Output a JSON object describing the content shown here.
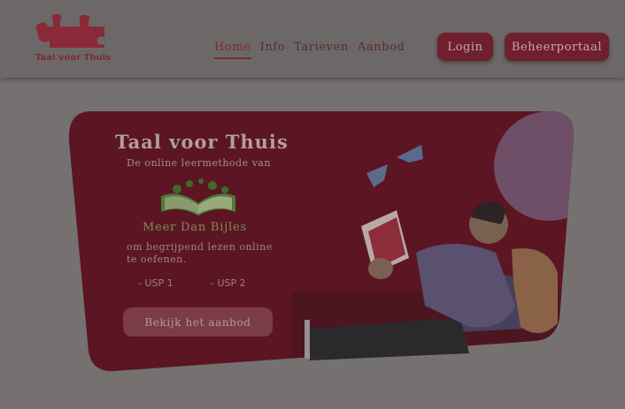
{
  "header": {
    "logo_text": "Taal voor Thuis",
    "nav": [
      {
        "label": "Home",
        "active": true
      },
      {
        "label": "Info",
        "active": false
      },
      {
        "label": "Tarieven",
        "active": false
      },
      {
        "label": "Aanbod",
        "active": false
      }
    ],
    "login_label": "Login",
    "portal_label": "Beheerportaal"
  },
  "hero": {
    "title": "Taal voor Thuis",
    "subtitle": "De online leermethode van",
    "product_name": "Meer Dan Bijles",
    "description": "om begrijpend lezen online te oefenen.",
    "usps": [
      "- USP 1",
      "- USP 2"
    ],
    "cta_label": "Bekijk het aanbod"
  },
  "colors": {
    "overlay_background": "#757171",
    "brand_red": "#6f1f2d",
    "hero_card": "#5c1522",
    "accent_green": "#4e7a3a",
    "illustration_purple": "#5a5070",
    "backpack_orange": "#8a6248"
  },
  "icons": {
    "logo": "puzzle-piece-icon",
    "book_logo": "open-book-icon",
    "illustration": "reading-person-illustration",
    "birds": "paper-bird-icon"
  }
}
